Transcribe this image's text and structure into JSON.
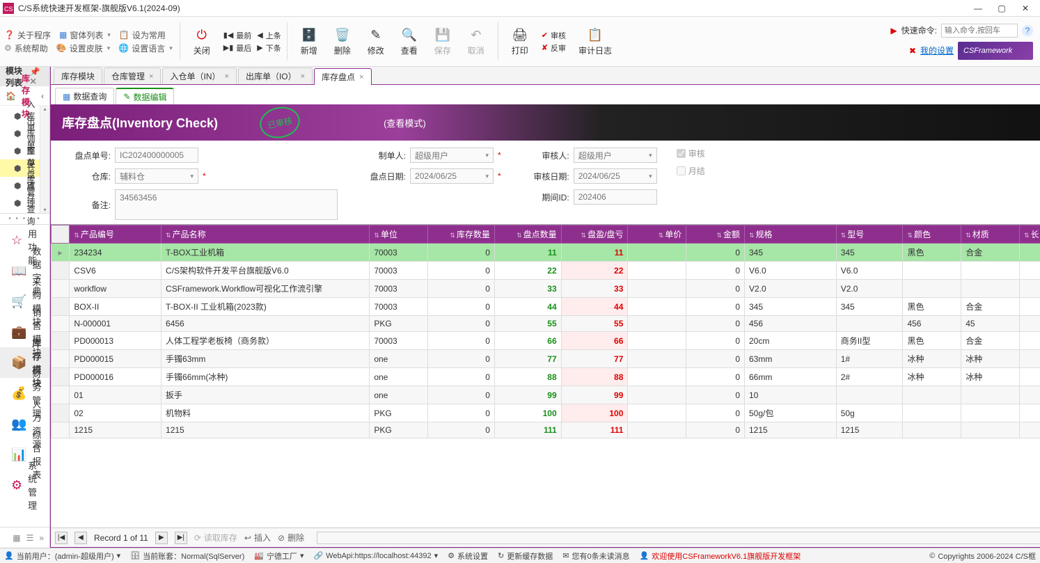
{
  "window": {
    "title": "C/S系统快速开发框架-旗舰版V6.1(2024-09)"
  },
  "topmenu": {
    "about": "关于程序",
    "formList": "窗体列表",
    "setCommon": "设为常用",
    "sysHelp": "系统帮助",
    "setSkin": "设置皮肤",
    "setLang": "设置语言",
    "close": "关闭",
    "first": "最前",
    "prev": "上条",
    "last": "最后",
    "next": "下条",
    "add": "新增",
    "delete": "删除",
    "edit": "修改",
    "view": "查看",
    "save": "保存",
    "cancel": "取消",
    "print": "打印",
    "approve": "审核",
    "reject": "反审",
    "audit": "审计日志",
    "quickCmd": "快速命令:",
    "quickPh": "输入命令,按回车",
    "mySettings": "我的设置",
    "brand": "CSFramework"
  },
  "sidebar": {
    "title": "模块列表",
    "groupTitle": "库存模块",
    "tree": [
      "入库单",
      "出库单",
      "调整单",
      "库存盘点",
      "仓库管理",
      "库存查询"
    ],
    "treeActive": 3,
    "nav": [
      "常用功能",
      "数据字典",
      "采购模块",
      "销售模块",
      "库存模块",
      "财务管理",
      "人力资源",
      "综合报表",
      "系统管理"
    ],
    "navActive": 4
  },
  "tabs": {
    "docs": [
      "库存模块",
      "仓库管理",
      "入仓单（IN）",
      "出库单（IO）",
      "库存盘点"
    ],
    "active": 4,
    "sub": {
      "query": "数据查询",
      "edit": "数据编辑"
    }
  },
  "band": {
    "title": "库存盘点(Inventory Check)",
    "stamp": "已审核",
    "mode": "(查看模式)"
  },
  "form": {
    "docNoLbl": "盘点单号:",
    "docNo": "IC202400000005",
    "whLbl": "仓库:",
    "wh": "辅料仓",
    "remarkLbl": "备注:",
    "remark": "34563456",
    "makerLbl": "制单人:",
    "maker": "超级用户",
    "dateLbl": "盘点日期:",
    "date": "2024/06/25",
    "approverLbl": "审核人:",
    "approver": "超级用户",
    "appDateLbl": "审核日期:",
    "appDate": "2024/06/25",
    "periodLbl": "期间ID:",
    "period": "202406",
    "chkApprove": "审核",
    "chkMonth": "月结"
  },
  "grid": {
    "cols": [
      "产品编号",
      "产品名称",
      "单位",
      "库存数量",
      "盘点数量",
      "盘盈/盘亏",
      "单价",
      "金额",
      "规格",
      "型号",
      "颜色",
      "材质",
      "长"
    ],
    "rows": [
      [
        "234234",
        "T-BOX工业机箱",
        "70003",
        "0",
        "11",
        "11",
        "",
        "0",
        "345",
        "345",
        "黑色",
        "合金",
        ""
      ],
      [
        "CSV6",
        "C/S架构软件开发平台旗舰版V6.0",
        "70003",
        "0",
        "22",
        "22",
        "",
        "0",
        "V6.0",
        "V6.0",
        "",
        "",
        ""
      ],
      [
        "workflow",
        "CSFramework.Workflow可视化工作流引擎",
        "70003",
        "0",
        "33",
        "33",
        "",
        "0",
        "V2.0",
        "V2.0",
        "",
        "",
        ""
      ],
      [
        "BOX-II",
        "T-BOX-II 工业机箱(2023款)",
        "70003",
        "0",
        "44",
        "44",
        "",
        "0",
        "345",
        "345",
        "黑色",
        "合金",
        ""
      ],
      [
        "N-000001",
        "6456",
        "PKG",
        "0",
        "55",
        "55",
        "",
        "0",
        "456",
        "",
        "456",
        "45",
        ""
      ],
      [
        "PD000013",
        "人体工程学老板椅（商务款）",
        "70003",
        "0",
        "66",
        "66",
        "",
        "0",
        "20cm",
        "商务II型",
        "黑色",
        "合金",
        ""
      ],
      [
        "PD000015",
        "手镯63mm",
        "one",
        "0",
        "77",
        "77",
        "",
        "0",
        "63mm",
        "1#",
        "冰种",
        "冰种",
        ""
      ],
      [
        "PD000016",
        "手镯66mm(冰种)",
        "one",
        "0",
        "88",
        "88",
        "",
        "0",
        "66mm",
        "2#",
        "冰种",
        "冰种",
        ""
      ],
      [
        "01",
        "扳手",
        "one",
        "0",
        "99",
        "99",
        "",
        "0",
        "10",
        "",
        "",
        "",
        ""
      ],
      [
        "02",
        "机物料",
        "PKG",
        "0",
        "100",
        "100",
        "",
        "0",
        "50g/包",
        "50g",
        "",
        "",
        ""
      ],
      [
        "1215",
        "1215",
        "PKG",
        "0",
        "111",
        "111",
        "",
        "0",
        "1215",
        "1215",
        "",
        "",
        ""
      ]
    ]
  },
  "gridFooter": {
    "record": "Record 1 of 11",
    "readStock": "读取库存",
    "insert": "插入",
    "delete": "删除"
  },
  "status": {
    "user": "当前用户：(admin-超级用户)",
    "account": "当前账套：Normal(SqlServer)",
    "factory": "宁德工厂",
    "webapi": "WebApi:https://localhost:44392",
    "sysSet": "系统设置",
    "refreshCache": "更新缓存数据",
    "msg": "您有0条未读消息",
    "welcome": "欢迎使用CSFrameworkV6.1旗舰版开发框架",
    "copyright": "Copyrights 2006-2024 C/S框"
  }
}
